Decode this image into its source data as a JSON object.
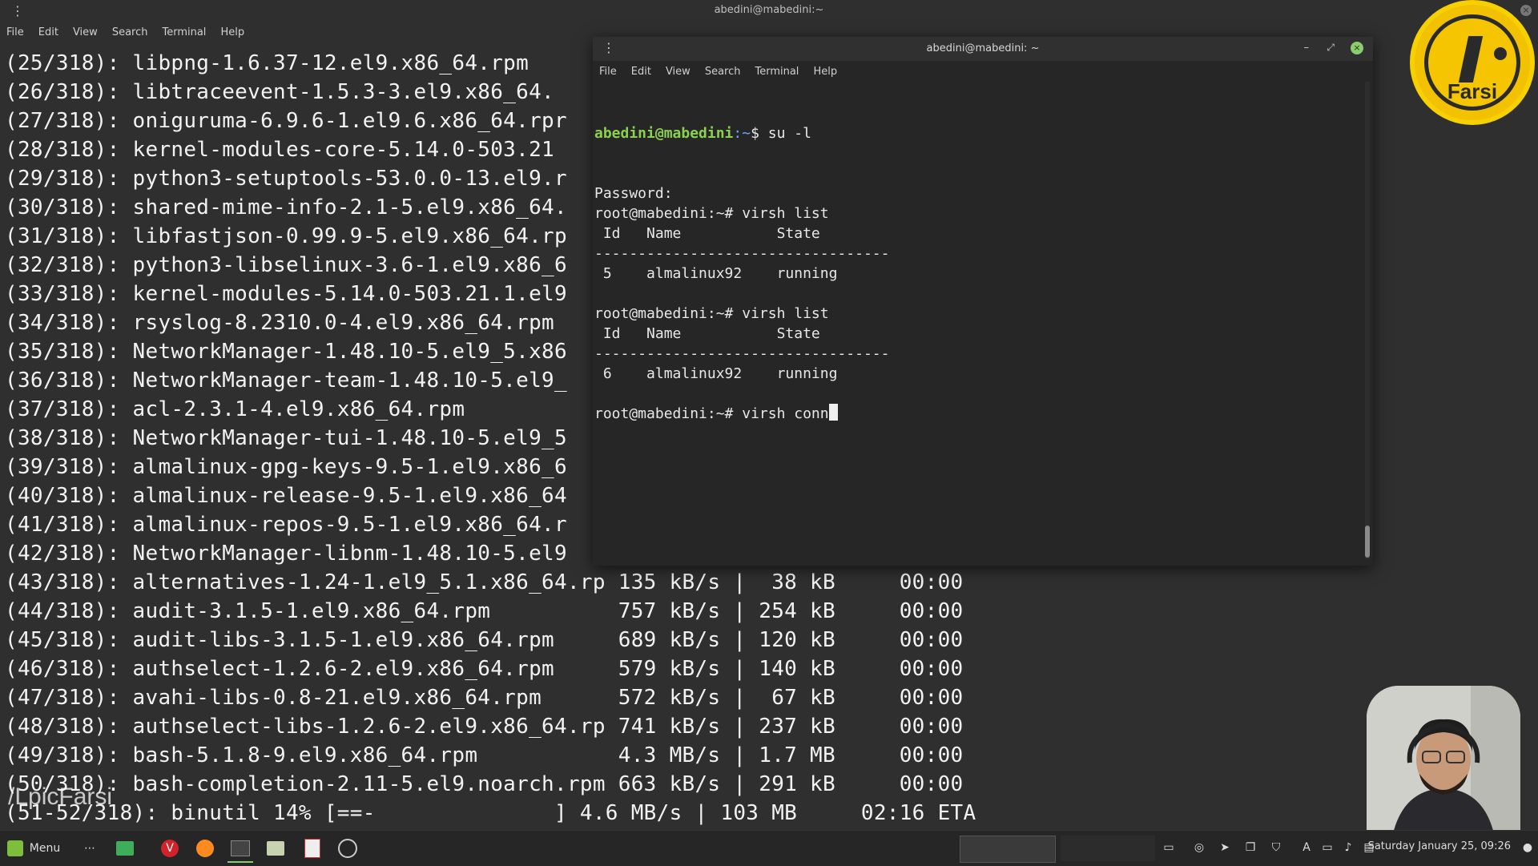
{
  "back_terminal": {
    "title": "abedini@mabedini:~",
    "menu": [
      "File",
      "Edit",
      "View",
      "Search",
      "Terminal",
      "Help"
    ],
    "lines": [
      "(25/318): libpng-1.6.37-12.el9.x86_64.rpm",
      "(26/318): libtraceevent-1.5.3-3.el9.x86_64.",
      "(27/318): oniguruma-6.9.6-1.el9.6.x86_64.rpr",
      "(28/318): kernel-modules-core-5.14.0-503.21",
      "(29/318): python3-setuptools-53.0.0-13.el9.r",
      "(30/318): shared-mime-info-2.1-5.el9.x86_64.",
      "(31/318): libfastjson-0.99.9-5.el9.x86_64.rp",
      "(32/318): python3-libselinux-3.6-1.el9.x86_6",
      "(33/318): kernel-modules-5.14.0-503.21.1.el9",
      "(34/318): rsyslog-8.2310.0-4.el9.x86_64.rpm",
      "(35/318): NetworkManager-1.48.10-5.el9_5.x86",
      "(36/318): NetworkManager-team-1.48.10-5.el9_",
      "(37/318): acl-2.3.1-4.el9.x86_64.rpm",
      "(38/318): NetworkManager-tui-1.48.10-5.el9_5",
      "(39/318): almalinux-gpg-keys-9.5-1.el9.x86_6",
      "(40/318): almalinux-release-9.5-1.el9.x86_64",
      "(41/318): almalinux-repos-9.5-1.el9.x86_64.r",
      "(42/318): NetworkManager-libnm-1.48.10-5.el9",
      "(43/318): alternatives-1.24-1.el9_5.1.x86_64.rp 135 kB/s |  38 kB     00:00",
      "(44/318): audit-3.1.5-1.el9.x86_64.rpm          757 kB/s | 254 kB     00:00",
      "(45/318): audit-libs-3.1.5-1.el9.x86_64.rpm     689 kB/s | 120 kB     00:00",
      "(46/318): authselect-1.2.6-2.el9.x86_64.rpm     579 kB/s | 140 kB     00:00",
      "(47/318): avahi-libs-0.8-21.el9.x86_64.rpm      572 kB/s |  67 kB     00:00",
      "(48/318): authselect-libs-1.2.6-2.el9.x86_64.rp 741 kB/s | 237 kB     00:00",
      "(49/318): bash-5.1.8-9.el9.x86_64.rpm           4.3 MB/s | 1.7 MB     00:00",
      "(50/318): bash-completion-2.11-5.el9.noarch.rpm 663 kB/s | 291 kB     00:00",
      "(51-52/318): binutil 14% [==-              ] 4.6 MB/s | 103 MB     02:16 ETA"
    ]
  },
  "front_terminal": {
    "title": "abedini@mabedini: ~",
    "menu": [
      "File",
      "Edit",
      "View",
      "Search",
      "Terminal",
      "Help"
    ],
    "prompt_user": "abedini@mabedini",
    "prompt_path": ":~",
    "first_cmd": "$ su -l",
    "lines": [
      "Password:",
      "root@mabedini:~# virsh list",
      " Id   Name           State",
      "----------------------------------",
      " 5    almalinux92    running",
      "",
      "root@mabedini:~# virsh list",
      " Id   Name           State",
      "----------------------------------",
      " 6    almalinux92    running",
      "",
      "root@mabedini:~# virsh conn"
    ]
  },
  "logo": {
    "text": "Farsi"
  },
  "watermark": "/LpicFarsi",
  "taskbar": {
    "menu_label": "Menu",
    "clock": "Saturday January 25, 09:26"
  },
  "colors": {
    "accent": "#8bcc6f",
    "logo": "#f2c100",
    "prompt_user": "#8bd14f"
  }
}
